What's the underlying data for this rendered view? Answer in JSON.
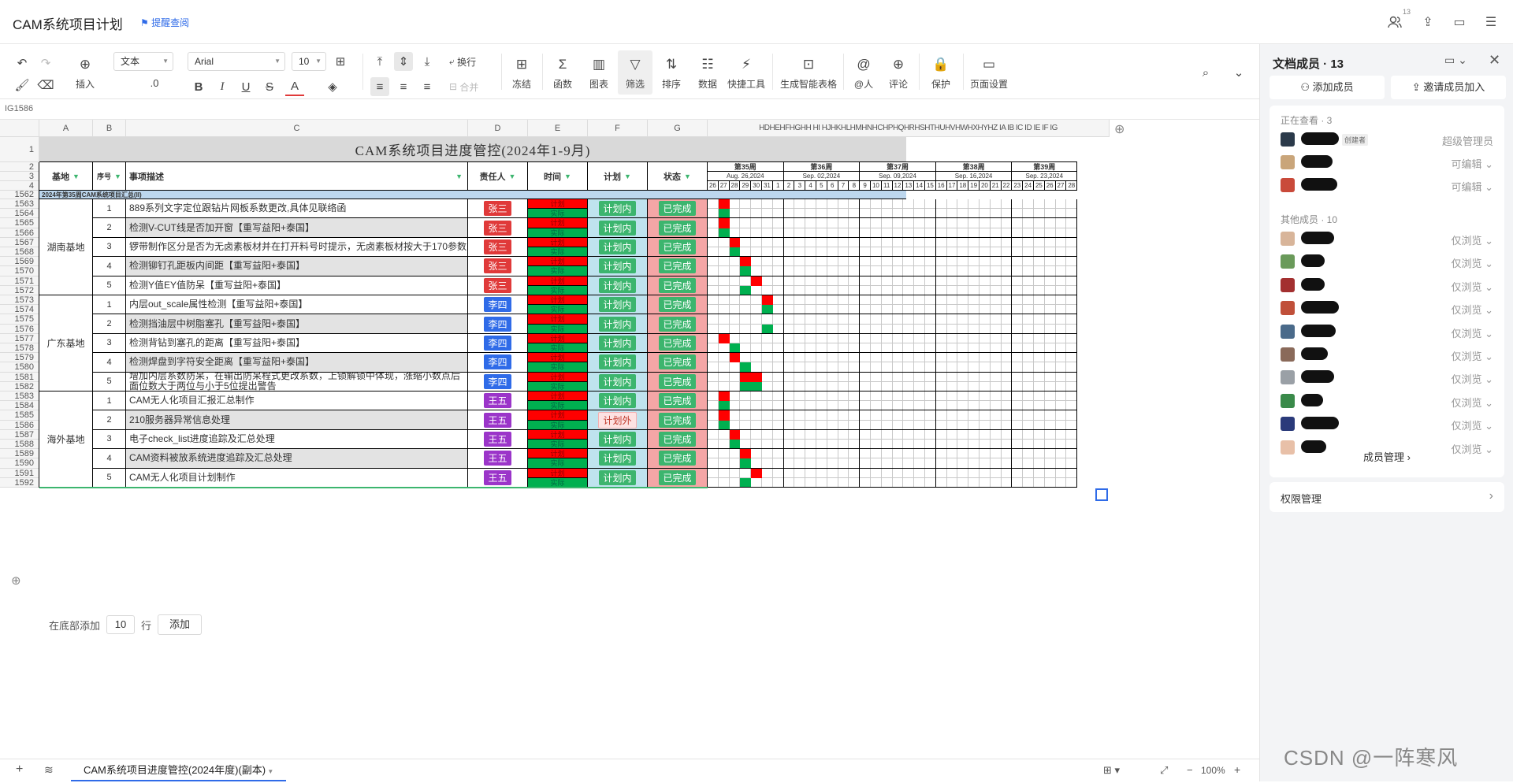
{
  "app": {
    "title": "CAM系统项目计划",
    "remind": "提醒查阅",
    "member_count_badge": "13"
  },
  "toolbar": {
    "insert": "插入",
    "text_format": "文本",
    "font": "Arial",
    "font_size": "10",
    "decimal": ".0",
    "wrap": "换行",
    "merge": "合并",
    "freeze": "冻结",
    "function": "函数",
    "chart": "图表",
    "filter": "筛选",
    "sort": "排序",
    "data": "数据",
    "quick_tools": "快捷工具",
    "smart_table": "生成智能表格",
    "mention": "@人",
    "comment": "评论",
    "protect": "保护",
    "page_setup": "页面设置"
  },
  "cell_ref": "IG1586",
  "columns": [
    "A",
    "B",
    "C",
    "D",
    "E",
    "F",
    "G"
  ],
  "extra_columns": "HDHEHFHGHH HI HJHKHLHMHNHCHPHQHRHSHTHUHVHWHXHYHZ IA IB IC ID IE IF IG",
  "row_numbers": [
    "1",
    "2",
    "3",
    "4",
    "1562",
    "1563",
    "1564",
    "1565",
    "1566",
    "1567",
    "1568",
    "1569",
    "1570",
    "1571",
    "1572",
    "1573",
    "1574",
    "1575",
    "1576",
    "1577",
    "1578",
    "1579",
    "1580",
    "1581",
    "1582",
    "1583",
    "1584",
    "1585",
    "1586",
    "1587",
    "1588",
    "1589",
    "1590",
    "1591",
    "1592"
  ],
  "sheet": {
    "title": "CAM系统项目进度管控(2024年1-9月)",
    "headers": {
      "base": "基地",
      "no": "序号",
      "desc": "事项描述",
      "owner": "责任人",
      "time": "时间",
      "plan": "计划",
      "status": "状态"
    },
    "group_label": "2024年第35周CAM系统项目汇总(II)",
    "weeks": [
      {
        "name": "第35周",
        "date": "Aug. 26,2024",
        "days": [
          "26",
          "27",
          "28",
          "29",
          "30",
          "31",
          "1"
        ]
      },
      {
        "name": "第36周",
        "date": "Sep. 02,2024",
        "days": [
          "2",
          "3",
          "4",
          "5",
          "6",
          "7",
          "8"
        ]
      },
      {
        "name": "第37周",
        "date": "Sep. 09,2024",
        "days": [
          "9",
          "10",
          "11",
          "12",
          "13",
          "14",
          "15"
        ]
      },
      {
        "name": "第38周",
        "date": "Sep. 16,2024",
        "days": [
          "16",
          "17",
          "18",
          "19",
          "20",
          "21",
          "22"
        ]
      },
      {
        "name": "第39周",
        "date": "Sep. 23,2024",
        "days": [
          "23",
          "24",
          "25",
          "26",
          "27",
          "28"
        ]
      }
    ],
    "time_labels": {
      "plan": "计划",
      "actual": "实际"
    },
    "sites": [
      {
        "name": "湖南基地",
        "owner_color": "#e03a3a",
        "tasks": [
          {
            "no": "1",
            "desc": "889系列文字定位跟钻片网板系数更改,具体见联络函",
            "owner": "张三",
            "plan": "计划内",
            "status": "已完成",
            "p": [
              1
            ],
            "a": [
              1
            ]
          },
          {
            "no": "2",
            "desc": "检测V-CUT线是否加开窗【重写益阳+泰国】",
            "owner": "张三",
            "plan": "计划内",
            "status": "已完成",
            "p": [
              1
            ],
            "a": [
              1
            ]
          },
          {
            "no": "3",
            "desc": "锣带制作区分是否为无卤素板材并在打开料号时提示，无卤素板材按大于170参数",
            "owner": "张三",
            "plan": "计划内",
            "status": "已完成",
            "p": [
              2
            ],
            "a": [
              2
            ]
          },
          {
            "no": "4",
            "desc": "检测铆钉孔距板内间距【重写益阳+泰国】",
            "owner": "张三",
            "plan": "计划内",
            "status": "已完成",
            "p": [
              3
            ],
            "a": [
              3
            ]
          },
          {
            "no": "5",
            "desc": "检测Y值EY值防呆【重写益阳+泰国】",
            "owner": "张三",
            "plan": "计划内",
            "status": "已完成",
            "p": [
              4
            ],
            "a": [
              3
            ]
          }
        ]
      },
      {
        "name": "广东基地",
        "owner_color": "#2f6be8",
        "tasks": [
          {
            "no": "1",
            "desc": "内层out_scale属性检测【重写益阳+泰国】",
            "owner": "李四",
            "plan": "计划内",
            "status": "已完成",
            "p": [
              5
            ],
            "a": [
              5
            ]
          },
          {
            "no": "2",
            "desc": "检测挡油层中树脂塞孔【重写益阳+泰国】",
            "owner": "李四",
            "plan": "计划内",
            "status": "已完成",
            "p": [],
            "a": [
              5
            ]
          },
          {
            "no": "3",
            "desc": "检测背钻到塞孔的距离【重写益阳+泰国】",
            "owner": "李四",
            "plan": "计划内",
            "status": "已完成",
            "p": [
              1
            ],
            "a": [
              2
            ]
          },
          {
            "no": "4",
            "desc": "检测焊盘到字符安全距离【重写益阳+泰国】",
            "owner": "李四",
            "plan": "计划内",
            "status": "已完成",
            "p": [
              2
            ],
            "a": [
              3
            ]
          },
          {
            "no": "5",
            "desc": "增加内层系数防呆，在输出防呆程式更改系数，上锁解锁中体现，涨缩小数点后面位数大于两位与小于5位提出警告",
            "owner": "李四",
            "plan": "计划内",
            "status": "已完成",
            "p": [
              3,
              4
            ],
            "a": [
              3,
              4
            ]
          }
        ]
      },
      {
        "name": "海外基地",
        "owner_color": "#9b35c9",
        "tasks": [
          {
            "no": "1",
            "desc": "CAM无人化项目汇报汇总制作",
            "owner": "王五",
            "plan": "计划内",
            "status": "已完成",
            "p": [
              1
            ],
            "a": [
              1
            ]
          },
          {
            "no": "2",
            "desc": "210服务器异常信息处理",
            "owner": "王五",
            "plan": "计划外",
            "status": "已完成",
            "p": [
              1
            ],
            "a": [
              1
            ]
          },
          {
            "no": "3",
            "desc": "电子check_list进度追踪及汇总处理",
            "owner": "王五",
            "plan": "计划内",
            "status": "已完成",
            "p": [
              2
            ],
            "a": [
              2
            ]
          },
          {
            "no": "4",
            "desc": "CAM资料被放系统进度追踪及汇总处理",
            "owner": "王五",
            "plan": "计划内",
            "status": "已完成",
            "p": [
              3
            ],
            "a": [
              3
            ]
          },
          {
            "no": "5",
            "desc": "CAM无人化项目计划制作",
            "owner": "王五",
            "plan": "计划内",
            "status": "已完成",
            "p": [
              4
            ],
            "a": [
              3
            ]
          }
        ]
      }
    ]
  },
  "add_rows": {
    "prefix": "在底部添加",
    "count": "10",
    "suffix": "行",
    "button": "添加"
  },
  "bottom": {
    "sheet_tab": "CAM系统项目进度管控(2024年度)(副本)",
    "zoom": "100%"
  },
  "panel": {
    "title": "文档成员 · 13",
    "add_member": "添加成员",
    "invite": "邀请成员加入",
    "viewing": "正在查看 · 3",
    "creator_tag": "创建者",
    "others": "其他成员 · 10",
    "manage_members": "成员管理",
    "permission": "权限管理",
    "viewing_members": [
      {
        "role": "超级管理员",
        "color": "#2b3a4a"
      },
      {
        "role": "可编辑",
        "color": "#c9a57a"
      },
      {
        "role": "可编辑",
        "color": "#c94a3a"
      }
    ],
    "other_members": [
      {
        "role": "仅浏览",
        "color": "#d8b59a"
      },
      {
        "role": "仅浏览",
        "color": "#6a9a5a"
      },
      {
        "role": "仅浏览",
        "color": "#a33030"
      },
      {
        "role": "仅浏览",
        "color": "#c0503a"
      },
      {
        "role": "仅浏览",
        "color": "#4a6a8a"
      },
      {
        "role": "仅浏览",
        "color": "#8a6a5a"
      },
      {
        "role": "仅浏览",
        "color": "#9aa0a6"
      },
      {
        "role": "仅浏览",
        "color": "#3a8a4a"
      },
      {
        "role": "仅浏览",
        "color": "#2a3a7a"
      },
      {
        "role": "仅浏览",
        "color": "#e8c0a8"
      }
    ]
  },
  "watermark": "CSDN @一阵寒风",
  "colors": {
    "plan_red": "#ff0000",
    "actual_green": "#00b050",
    "plan_bg": "#bfe3ee",
    "status_bg": "#f4a6a6",
    "badge_green": "#3cb56e",
    "title_bg": "#d9d9d9",
    "group_bg": "#bdd7ee"
  }
}
